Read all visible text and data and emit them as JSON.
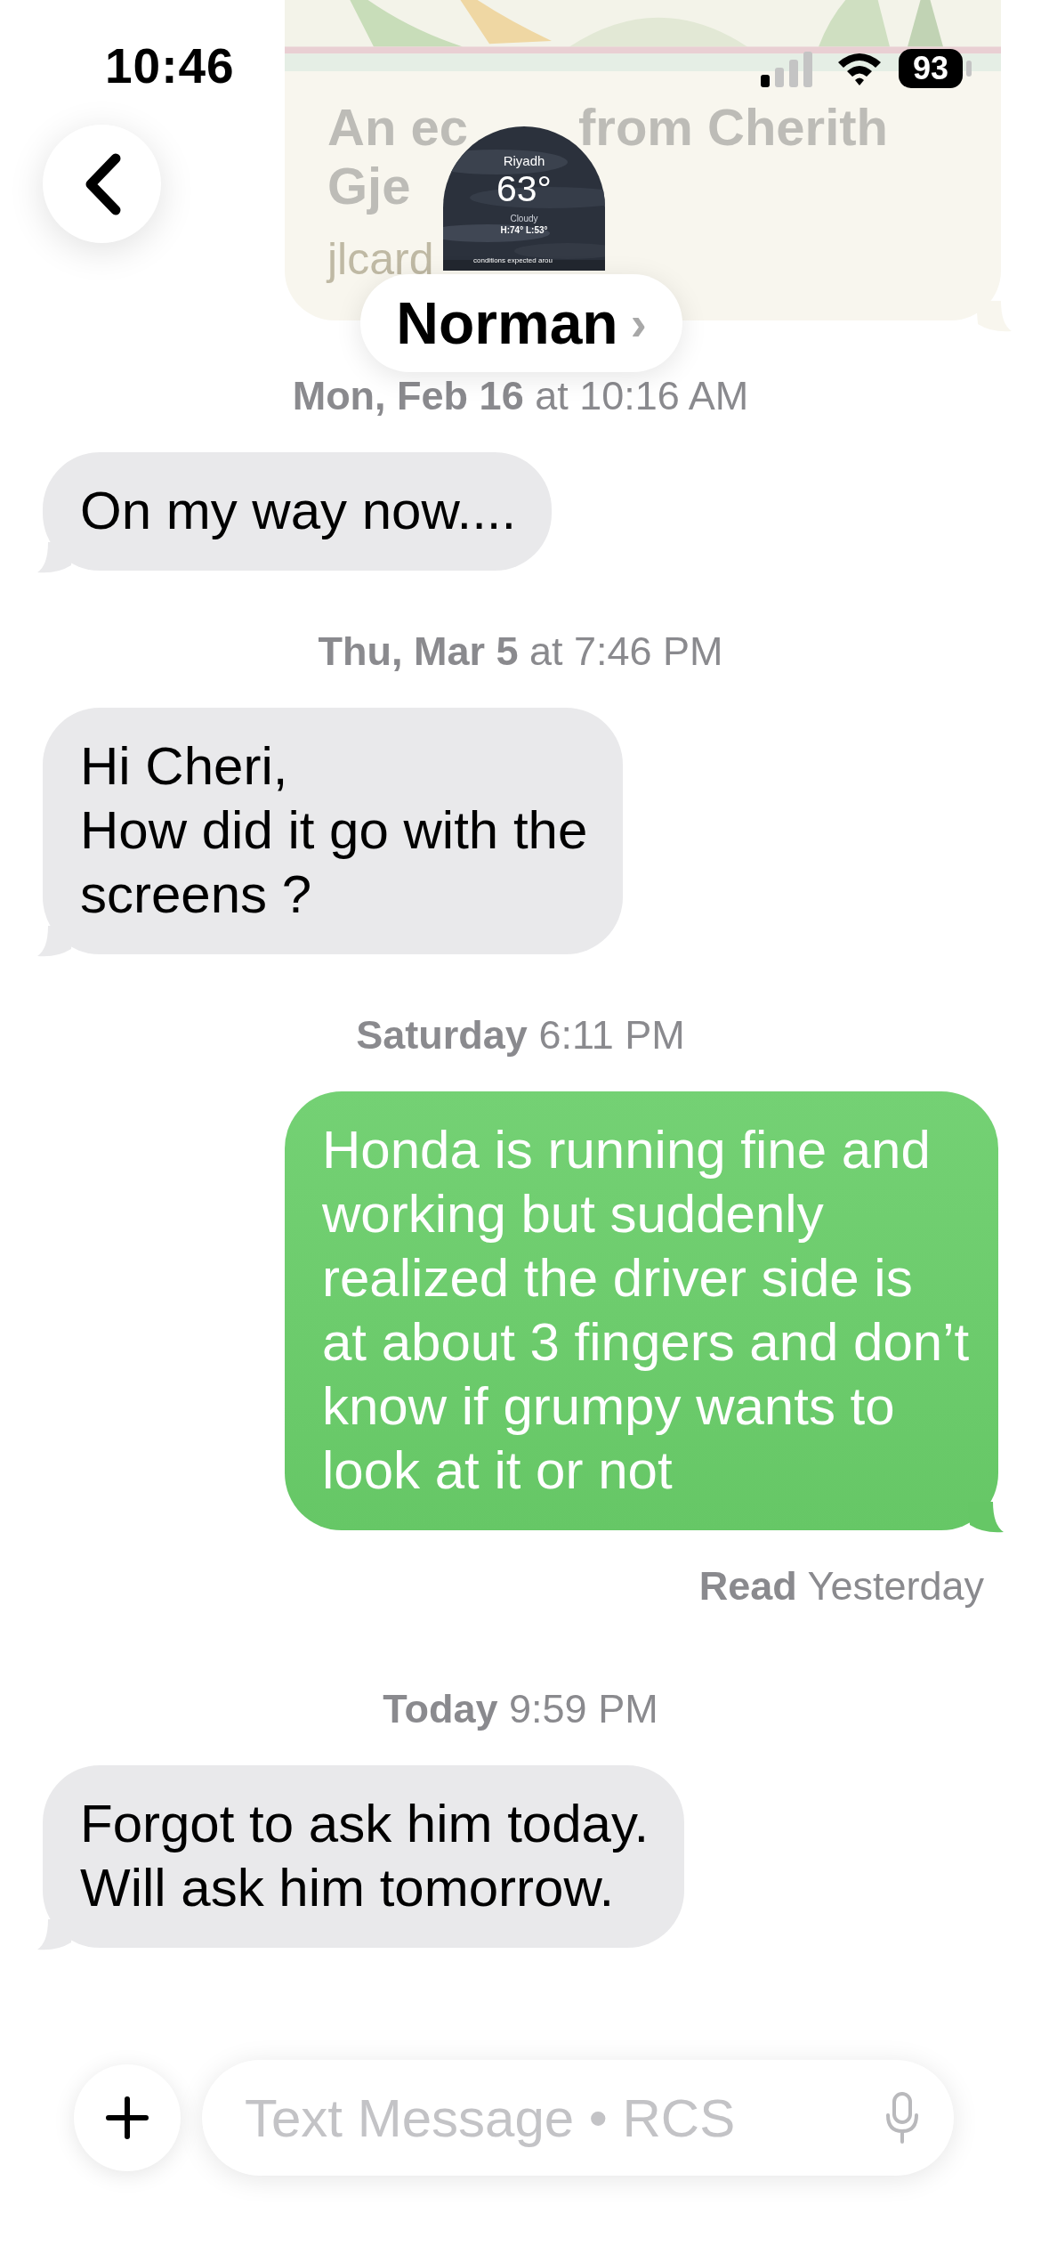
{
  "status_bar": {
    "time": "10:46",
    "battery": "93"
  },
  "background_card": {
    "kind": "picture",
    "title_parts": [
      "An ec",
      "from Cherith",
      "Gje"
    ],
    "source": "jlcard"
  },
  "header": {
    "contact": "Norman",
    "chevron": "›",
    "avatar": {
      "city": "Riyadh",
      "temperature": "63°",
      "condition": "Cloudy",
      "range": "H:74° L:53°",
      "ticker": "conditions expected arou"
    }
  },
  "messages": [
    {
      "kind": "timestamp",
      "text": "**Mon, Feb 16** at 10:16 AM"
    },
    {
      "kind": "received",
      "text": "On my way now...."
    },
    {
      "kind": "timestamp",
      "text": "**Thu, Mar 5** at 7:46 PM"
    },
    {
      "kind": "received",
      "text": "Hi Cheri,\nHow did it go with the\nscreens ?"
    },
    {
      "kind": "timestamp",
      "text": "**Saturday** 6:11 PM"
    },
    {
      "kind": "sent",
      "text": "Honda is running fine and working but suddenly realized the driver side is at about 3 fingers and don’t know if grumpy wants to look at it or not"
    },
    {
      "kind": "receipt",
      "text": "**Read** Yesterday"
    },
    {
      "kind": "timestamp",
      "text": "**Today** 9:59 PM"
    },
    {
      "kind": "received",
      "text": "Forgot to ask him today.\nWill ask him tomorrow."
    }
  ],
  "composer": {
    "placeholder": "Text Message • RCS"
  }
}
